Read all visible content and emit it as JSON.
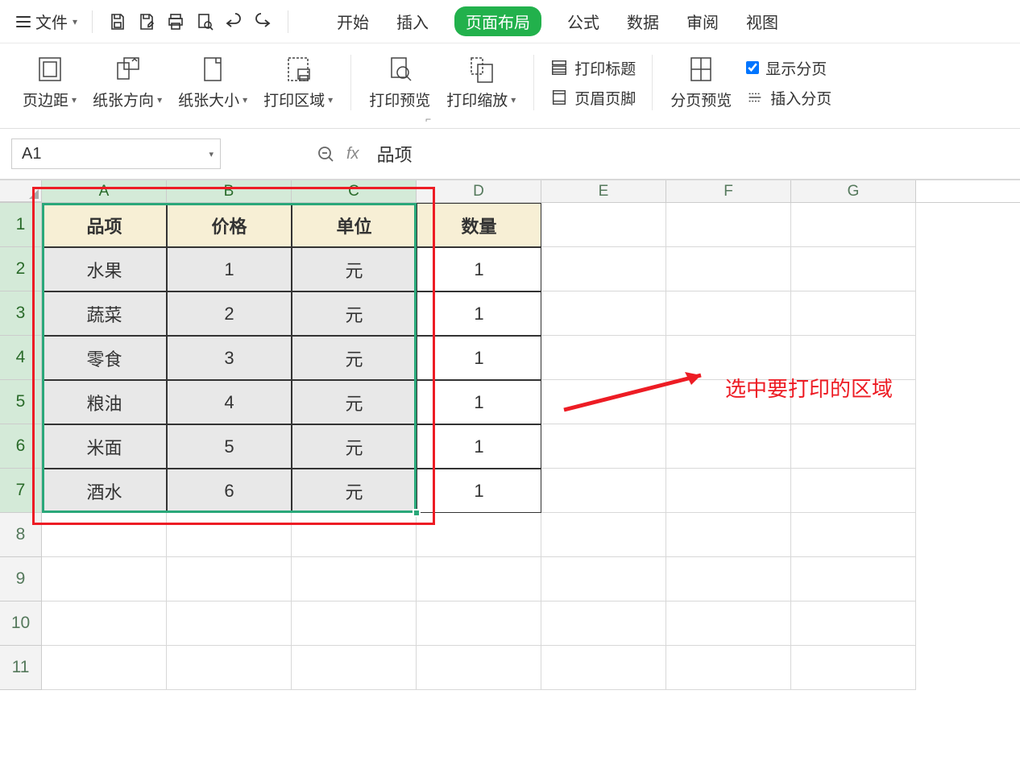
{
  "top": {
    "file": "文件"
  },
  "menu": {
    "start": "开始",
    "insert": "插入",
    "pagelayout": "页面布局",
    "formula": "公式",
    "data": "数据",
    "review": "审阅",
    "view": "视图"
  },
  "ribbon": {
    "margins": "页边距",
    "orientation": "纸张方向",
    "size": "纸张大小",
    "printarea": "打印区域",
    "preview": "打印预览",
    "scaling": "打印缩放",
    "titles": "打印标题",
    "headerfooter": "页眉页脚",
    "pagebreak": "分页预览",
    "showbreak": "显示分页",
    "insertbreak": "插入分页"
  },
  "fbar": {
    "cellref": "A1",
    "value": "品项"
  },
  "cols": [
    "A",
    "B",
    "C",
    "D",
    "E",
    "F",
    "G"
  ],
  "table": {
    "headers": [
      "品项",
      "价格",
      "单位",
      "数量"
    ],
    "rows": [
      [
        "水果",
        "1",
        "元",
        "1"
      ],
      [
        "蔬菜",
        "2",
        "元",
        "1"
      ],
      [
        "零食",
        "3",
        "元",
        "1"
      ],
      [
        "粮油",
        "4",
        "元",
        "1"
      ],
      [
        "米面",
        "5",
        "元",
        "1"
      ],
      [
        "酒水",
        "6",
        "元",
        "1"
      ]
    ]
  },
  "annotation": "选中要打印的区域"
}
